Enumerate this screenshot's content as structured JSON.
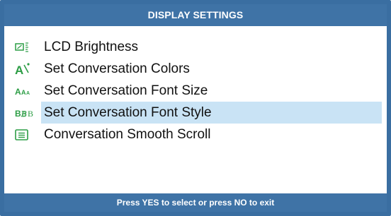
{
  "header": {
    "title": "DISPLAY SETTINGS"
  },
  "menu": {
    "selected_index": 3,
    "items": [
      {
        "label": "LCD Brightness",
        "icon": "brightness-icon"
      },
      {
        "label": "Set Conversation Colors",
        "icon": "text-color-icon"
      },
      {
        "label": "Set Conversation Font Size",
        "icon": "font-size-icon"
      },
      {
        "label": "Set Conversation Font Style",
        "icon": "font-style-icon"
      },
      {
        "label": "Conversation Smooth Scroll",
        "icon": "smooth-scroll-icon"
      }
    ]
  },
  "footer": {
    "hint": "Press YES to select or press NO to exit"
  },
  "colors": {
    "frame": "#3a6ea1",
    "bar": "#3f73a6",
    "selection": "#c9e3f5",
    "icon_green": "#2c9d45"
  }
}
